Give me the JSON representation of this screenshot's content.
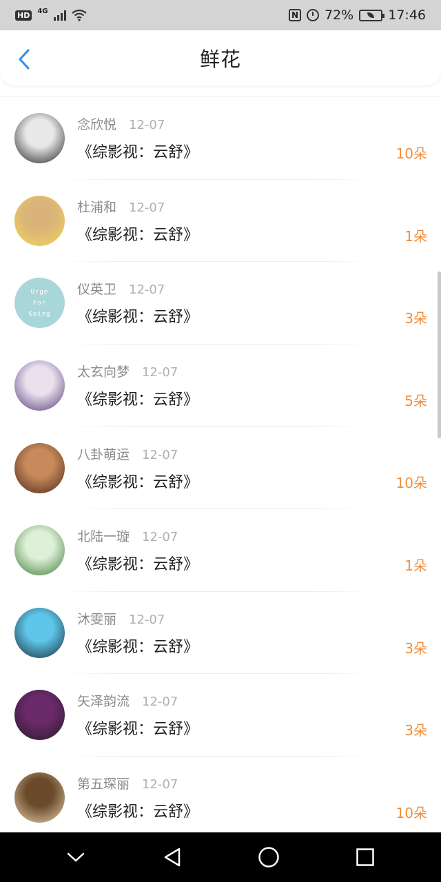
{
  "status_bar": {
    "hd": "HD",
    "network": "4G",
    "battery_percent": "72%",
    "time": "17:46"
  },
  "header": {
    "title": "鲜花",
    "back_icon": "chevron-left-icon",
    "accent": "#2a8cf0"
  },
  "colors": {
    "count_orange": "#f08d3c"
  },
  "items": [
    {
      "name": "念欣悦",
      "date": "12-07",
      "book": "《综影视：云舒》",
      "count": "10朵",
      "avatar_colors": [
        "#222222",
        "#e8e8e8"
      ]
    },
    {
      "name": "杜浦和",
      "date": "12-07",
      "book": "《综影视：云舒》",
      "count": "1朵",
      "avatar_colors": [
        "#f3d55a",
        "#d9b37a"
      ]
    },
    {
      "name": "仪英卫",
      "date": "12-07",
      "book": "《综影视：云舒》",
      "count": "3朵",
      "avatar_colors": [
        "#a9d7d9",
        "#a9d7d9"
      ],
      "avatar_text": [
        "Urge",
        "For",
        "Going"
      ]
    },
    {
      "name": "太玄向梦",
      "date": "12-07",
      "book": "《综影视：云舒》",
      "count": "5朵",
      "avatar_colors": [
        "#5a3a7a",
        "#e9e2ee"
      ]
    },
    {
      "name": "八卦萌运",
      "date": "12-07",
      "book": "《综影视：云舒》",
      "count": "10朵",
      "avatar_colors": [
        "#4a2a1a",
        "#c88a5a"
      ]
    },
    {
      "name": "北陆一璇",
      "date": "12-07",
      "book": "《综影视：云舒》",
      "count": "1朵",
      "avatar_colors": [
        "#3d7a3a",
        "#dff0d8"
      ]
    },
    {
      "name": "沐雯丽",
      "date": "12-07",
      "book": "《综影视：云舒》",
      "count": "3朵",
      "avatar_colors": [
        "#1a2a3a",
        "#5ec6e8"
      ]
    },
    {
      "name": "矢泽韵流",
      "date": "12-07",
      "book": "《综影视：云舒》",
      "count": "3朵",
      "avatar_colors": [
        "#2a1a2a",
        "#6a2a6a"
      ]
    },
    {
      "name": "第五琛丽",
      "date": "12-07",
      "book": "《综影视：云舒》",
      "count": "10朵",
      "avatar_colors": [
        "#e8d0b0",
        "#6a4a2a"
      ]
    }
  ],
  "nav": {
    "collapse_icon": "chevron-down-icon",
    "back_icon": "triangle-back-icon",
    "home_icon": "circle-home-icon",
    "recents_icon": "square-recents-icon"
  }
}
